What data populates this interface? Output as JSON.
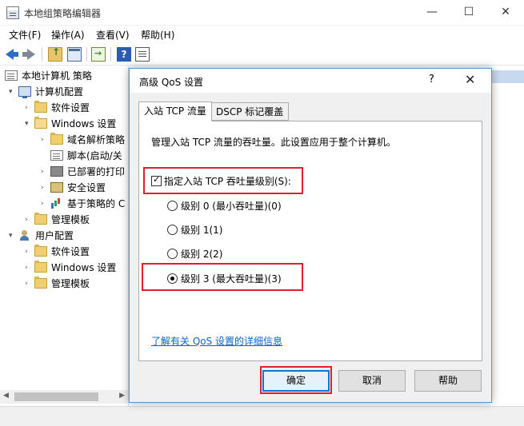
{
  "window": {
    "title": "本地组策略编辑器",
    "minimize": "—",
    "maximize": "☐",
    "close": "✕"
  },
  "menu": [
    "文件(F)",
    "操作(A)",
    "查看(V)",
    "帮助(H)"
  ],
  "tree": {
    "root": "本地计算机 策略",
    "computer_config": "计算机配置",
    "software_settings": "软件设置",
    "windows_settings": "Windows 设置",
    "dns_policy": "域名解析策略",
    "scripts": "脚本(启动/关",
    "printers": "已部署的打印",
    "security": "安全设置",
    "qos_policy": "基于策略的 C",
    "admin_templates": "管理模板",
    "user_config": "用户配置",
    "user_software": "软件设置",
    "user_windows": "Windows 设置",
    "user_admin": "管理模板"
  },
  "dialog": {
    "title": "高级 QoS 设置",
    "help": "?",
    "close": "✕",
    "tabs": [
      "入站 TCP 流量",
      "DSCP 标记覆盖"
    ],
    "description": "管理入站 TCP 流量的吞吐量。此设置应用于整个计算机。",
    "checkbox_label": "指定入站 TCP 吞吐量级别(S):",
    "options": [
      {
        "label": "级别 0 (最小吞吐量)(0)",
        "selected": false
      },
      {
        "label": "级别 1(1)",
        "selected": false
      },
      {
        "label": "级别 2(2)",
        "selected": false
      },
      {
        "label": "级别 3 (最大吞吐量)(3)",
        "selected": true
      }
    ],
    "link": "了解有关 QoS 设置的详细信息",
    "ok": "确定",
    "cancel": "取消",
    "help_button": "帮助"
  },
  "colors": {
    "highlight": "#e0202a",
    "link": "#0a64c8",
    "accent": "#0078d7"
  }
}
